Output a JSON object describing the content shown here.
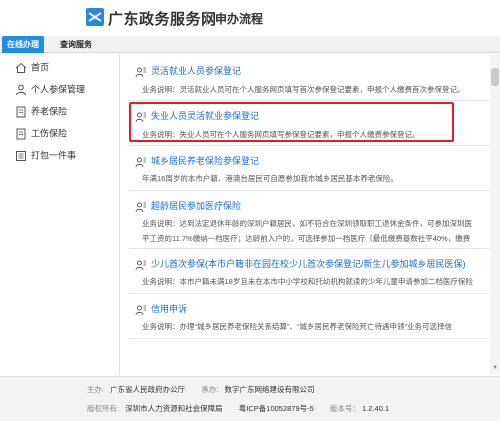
{
  "header": {
    "site_title": "广东政务服务网",
    "page_subtitle": "申办流程"
  },
  "tabs": [
    {
      "label": "在线办理",
      "active": true
    },
    {
      "label": "查询服务",
      "active": false
    }
  ],
  "sidebar": {
    "items": [
      {
        "label": "首页",
        "icon": "home-icon"
      },
      {
        "label": "个人参保管理",
        "icon": "person-icon"
      },
      {
        "label": "养老保险",
        "icon": "document-icon"
      },
      {
        "label": "工伤保险",
        "icon": "document-icon"
      },
      {
        "label": "打包一件事",
        "icon": "list-icon"
      }
    ]
  },
  "services": [
    {
      "title": "灵活就业人员参保登记",
      "desc": "业务说明：灵活就业人员可在个人服务网页填写首次参保登记要素，申报个人缴费首次参保登记。"
    },
    {
      "title": "失业人员灵活就业参保登记",
      "desc": "业务说明：失业人员可在个人服务网页填写参保登记要素，申报个人缴费参保登记。",
      "highlighted": true
    },
    {
      "title": "城乡居民养老保险参保登记",
      "desc": "年满16周岁的本市户籍、港澳台居民可自愿参加我市城乡居民基本养老保险。"
    },
    {
      "title": "超龄居民参加医疗保险",
      "desc": "业务说明：达到法定退休年龄的深圳户籍居民，如不符合在深圳领取职工退休金条件，可参加深圳医",
      "desc2": "平工资的11.7%缴纳一档医疗；达龄前入户的，可选择参加一档医疗（最低缴费基数社平40%，缴费"
    },
    {
      "title": "少儿首次参保(本市户籍非在园在校少儿首次参保登记/新生儿参加城乡居民医保)",
      "desc": "业务说明：本市户籍未满18岁且未在本市中小学校和托幼机构就读的少年儿童申请参加二档医疗保险"
    },
    {
      "title": "信用申诉",
      "desc": "业务说明：办理“城乡居民养老保险关系结算”、“城乡居民养老保险死亡待遇申领”业务可选择信"
    }
  ],
  "footer": {
    "host_label": "主办:",
    "host_value": "广东省人民政府办公厅",
    "undertaker_label": "承办:",
    "undertaker_value": "数字广东网络建设有限公司",
    "copyright_label": "版权所有:",
    "copyright_value": "深圳市人力资源和社会保障局",
    "icp": "粤ICP备10052879号-5",
    "version_label": "版本号：",
    "version_value": "1.2.40.1"
  },
  "colors": {
    "accent": "#1e8ee6",
    "link": "#1a6fcf",
    "highlight_border": "#e02020"
  }
}
